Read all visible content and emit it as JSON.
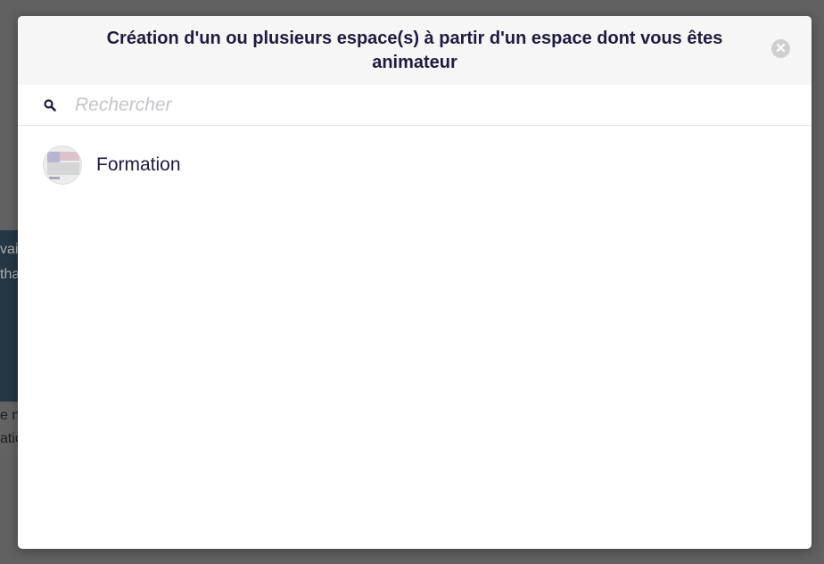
{
  "background": {
    "card_text_lines": [
      "vai",
      "tha"
    ],
    "caption_lines": [
      "e n",
      "atio"
    ]
  },
  "modal": {
    "title": "Création d'un ou plusieurs espace(s) à partir d'un espace dont vous êtes animateur",
    "close_icon": "close-circle-icon",
    "search": {
      "icon": "search-icon",
      "placeholder": "Rechercher",
      "value": ""
    },
    "spaces": [
      {
        "name": "Formation",
        "avatar": "space-thumbnail"
      }
    ]
  },
  "colors": {
    "title": "#1e1c3f",
    "header_bg": "#f6f6f6",
    "placeholder": "#c4c4cc",
    "overlay": "#5b5b5b"
  }
}
